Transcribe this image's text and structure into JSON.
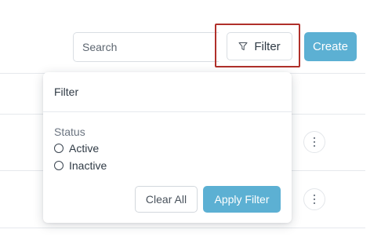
{
  "toolbar": {
    "search_placeholder": "Search",
    "filter_label": "Filter",
    "create_label": "Create"
  },
  "filter_panel": {
    "title": "Filter",
    "status_label": "Status",
    "options": [
      {
        "label": "Active",
        "selected": false
      },
      {
        "label": "Inactive",
        "selected": false
      }
    ],
    "clear_label": "Clear All",
    "apply_label": "Apply Filter"
  },
  "table": {
    "row_action_icon": "kebab-menu-icon"
  },
  "colors": {
    "accent": "#5cb0d3",
    "highlight": "#b0302a"
  }
}
